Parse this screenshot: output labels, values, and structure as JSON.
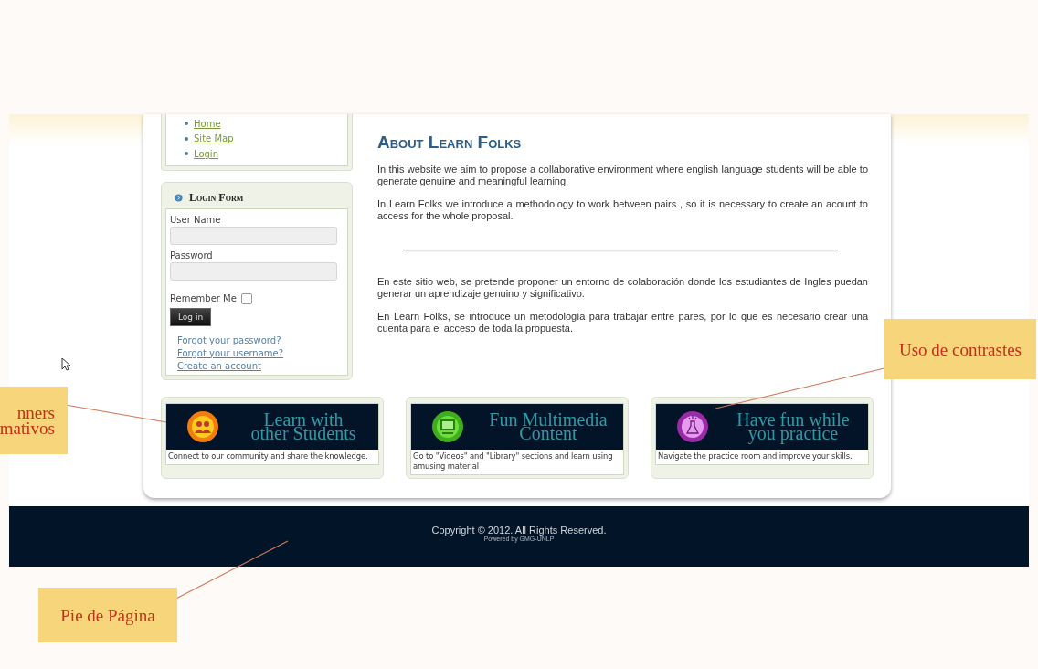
{
  "nav": {
    "items": [
      "Home",
      "Site Map",
      "Login"
    ]
  },
  "login_form": {
    "title": "Login Form",
    "fields": [
      {
        "label": "User Name"
      },
      {
        "label": "Password"
      }
    ],
    "remember": {
      "label": "Remember Me",
      "checked": false
    },
    "button": "Log in",
    "links": [
      "Forgot your password?",
      "Forgot your username?",
      "Create an account"
    ]
  },
  "article": {
    "title": "About Learn Folks",
    "paragraphs_en": [
      "In this website we aim to propose a collaborative environment where english language students will be able to generate genuine and meaningful learning.",
      "In Learn Folks we introduce a methodology to work between pairs , so it is necessary to create an acount to access for the whole proposal."
    ],
    "paragraphs_es": [
      "En este sitio web, se pretende proponer un entorno de colaboración donde los estudiantes de Ingles puedan generar un aprendizaje genuino y significativo.",
      "En Learn Folks, se introduce un metodología para trabajar entre pares, por lo que es necesario crear una cuenta para el acceso de toda la propuesta."
    ]
  },
  "features": [
    {
      "kind": "people",
      "color": "#f27d0c",
      "title_lines": [
        "Learn with",
        "other Students"
      ],
      "description": "Connect to our community and share the knowledge."
    },
    {
      "kind": "computer",
      "color": "#3fae1e",
      "title_lines": [
        "Fun Multimedia",
        "Content"
      ],
      "description": "Go to \"Videos\" and \"Library\" sections and learn using amusing material"
    },
    {
      "kind": "flask",
      "color": "#9a2aa8",
      "title_lines": [
        "Have fun while",
        "you practice"
      ],
      "description": "Navigate the practice room and improve your skills."
    }
  ],
  "footer": {
    "copyright": "Copyright © 2012. All Rights Reserved.",
    "powered": "Powered by GMG-UNLP"
  },
  "callouts": [
    {
      "lines": [
        "nners",
        "mativos"
      ]
    },
    {
      "lines": [
        "Uso de contrastes"
      ]
    },
    {
      "lines": [
        "Pie de Página"
      ]
    }
  ]
}
